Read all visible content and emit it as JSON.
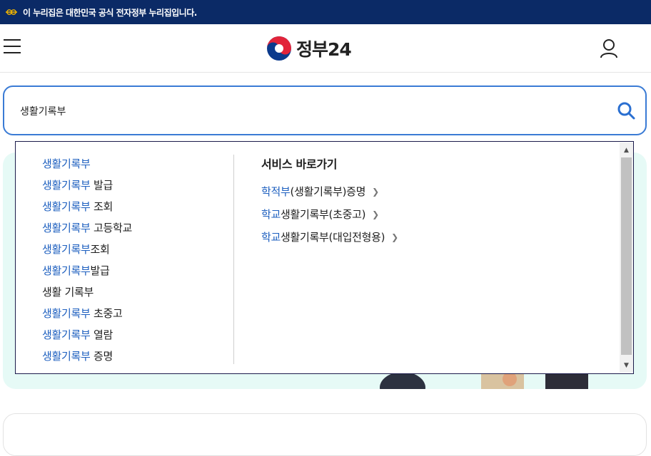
{
  "gov_notice": {
    "text": "이 누리집은 대한민국 공식 전자정부 누리집입니다."
  },
  "header": {
    "logo_text": "정부24"
  },
  "search": {
    "value": "생활기록부"
  },
  "suggestions": [
    {
      "highlight": "생활기록부",
      "rest": ""
    },
    {
      "highlight": "생활기록부",
      "rest": " 발급"
    },
    {
      "highlight": "생활기록부",
      "rest": " 조회"
    },
    {
      "highlight": "생활기록부",
      "rest": " 고등학교"
    },
    {
      "highlight": "생활기록부",
      "rest": "조회"
    },
    {
      "highlight": "생활기록부",
      "rest": "발급"
    },
    {
      "highlight": "",
      "rest": "생활 기록부"
    },
    {
      "highlight": "생활기록부",
      "rest": " 초중고"
    },
    {
      "highlight": "생활기록부",
      "rest": " 열람"
    },
    {
      "highlight": "생활기록부",
      "rest": " 증명"
    }
  ],
  "quick_links": {
    "title": "서비스 바로가기",
    "items": [
      {
        "highlight": "학적부",
        "rest": "(생활기록부)증명"
      },
      {
        "highlight": "학교",
        "rest": "생활기록부(초중고)"
      },
      {
        "highlight": "학교",
        "rest": "생활기록부(대입전형용)"
      }
    ]
  },
  "colors": {
    "gov_bar": "#0b2a66",
    "accent": "#1d5fbf",
    "search_border": "#3a7bd5",
    "banner_bg": "#e6faf6"
  }
}
